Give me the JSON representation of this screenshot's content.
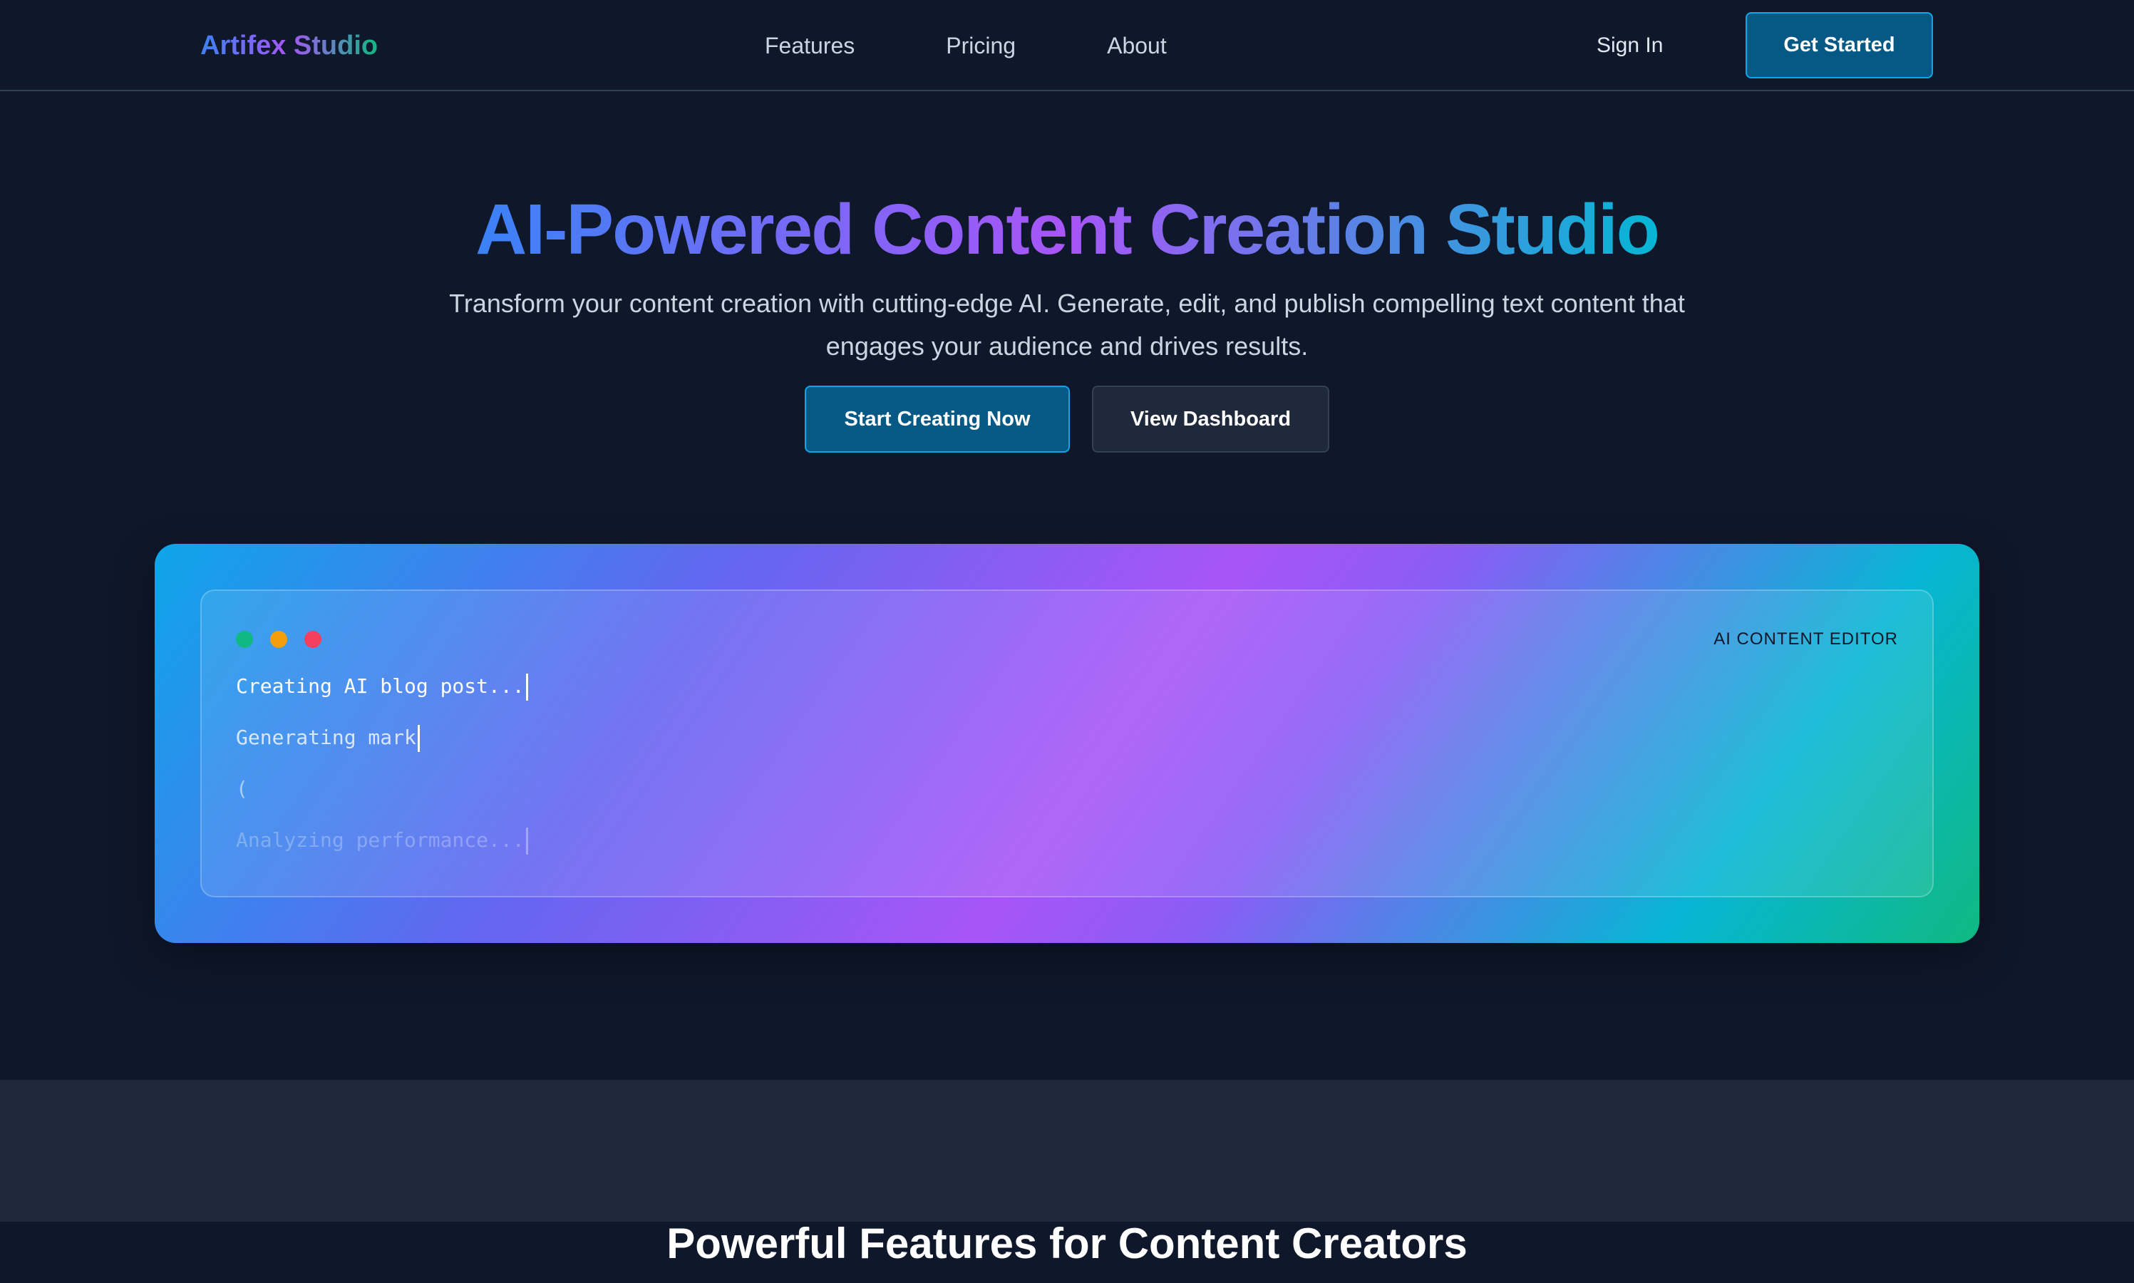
{
  "nav": {
    "logo": "Artifex Studio",
    "links": [
      "Features",
      "Pricing",
      "About"
    ],
    "sign_in": "Sign In",
    "get_started": "Get Started"
  },
  "hero": {
    "title": "AI-Powered Content Creation Studio",
    "subtitle": "Transform your content creation with cutting-edge AI. Generate, edit, and publish compelling text content that engages your audience and drives results.",
    "primary_cta": "Start Creating Now",
    "secondary_cta": "View Dashboard"
  },
  "editor": {
    "label": "AI CONTENT EDITOR",
    "lines": [
      "Creating AI blog post...",
      "Generating mark",
      "(",
      "Analyzing performance..."
    ],
    "window_dots": [
      "green-dot",
      "yellow-dot",
      "red-dot"
    ]
  },
  "features": {
    "title": "Powerful Features for Content Creators"
  },
  "colors": {
    "background": "#0f172a",
    "accent": "#075985",
    "accent_border": "#0ea5e9",
    "features_bg": "#1e293b"
  }
}
